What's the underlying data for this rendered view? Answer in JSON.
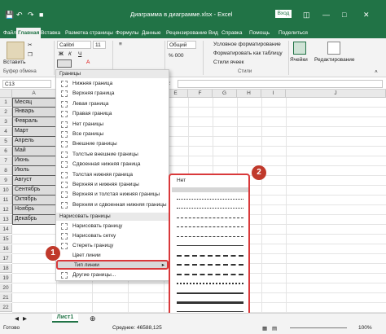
{
  "window": {
    "title": "Диаграмма в диаграмме.xlsx  -  Excel",
    "login": "Вход"
  },
  "tabs": [
    "Файл",
    "Главная",
    "Вставка",
    "Разметка страницы",
    "Формулы",
    "Данные",
    "Рецензирование",
    "Вид",
    "Справка",
    "Помощь",
    "Поделиться"
  ],
  "ribbon": {
    "paste_label": "Вставить",
    "font_name": "Calibri",
    "font_size": "11",
    "number_format": "Общий",
    "styles": [
      "Условное форматирование",
      "Форматировать как таблицу",
      "Стили ячеек"
    ],
    "cells_label": "Ячейки",
    "editing_label": "Редактирование",
    "group_clipboard": "Буфер обмена",
    "group_styles": "Стили"
  },
  "formula_bar": {
    "name_box": "C13",
    "fx": "fx"
  },
  "columns": [
    "A",
    "B",
    "C",
    "D",
    "E",
    "F",
    "G",
    "H",
    "I",
    "J"
  ],
  "rows": [
    "1",
    "2",
    "3",
    "4",
    "5",
    "6",
    "7",
    "8",
    "9",
    "10",
    "11",
    "12",
    "13",
    "14",
    "15",
    "16",
    "17",
    "18",
    "19",
    "20",
    "21",
    "22"
  ],
  "col_a": [
    "Месяц",
    "Январь",
    "Февраль",
    "Март",
    "Апрель",
    "Май",
    "Июнь",
    "Июль",
    "Август",
    "Сентябрь",
    "Октябрь",
    "Ноябрь",
    "Декабрь"
  ],
  "borders_menu": {
    "header": "Границы",
    "items": [
      "Нижняя граница",
      "Верхняя граница",
      "Левая граница",
      "Правая граница",
      "Нет границы",
      "Все границы",
      "Внешние границы",
      "Толстые внешние границы",
      "Сдвоенная нижняя граница",
      "Толстая нижняя граница",
      "Верхняя и нижняя границы",
      "Верхняя и толстая нижняя границы",
      "Верхняя и сдвоенная нижняя границы"
    ],
    "draw_header": "Нарисовать границы",
    "draw_items": [
      "Нарисовать границу",
      "Нарисовать сетку",
      "Стереть границу",
      "Цвет линии",
      "Тип линии",
      "Другие границы..."
    ]
  },
  "line_style_submenu": {
    "none_label": "Нет"
  },
  "callouts": [
    "1",
    "2"
  ],
  "sheet_tab": "Лист1",
  "status": {
    "ready": "Готово",
    "average": "Среднее: 46588,125",
    "zoom": "100%"
  },
  "colors": {
    "excel_green": "#217346",
    "callout_red": "#c0392b",
    "highlight_red": "#d9393b"
  }
}
